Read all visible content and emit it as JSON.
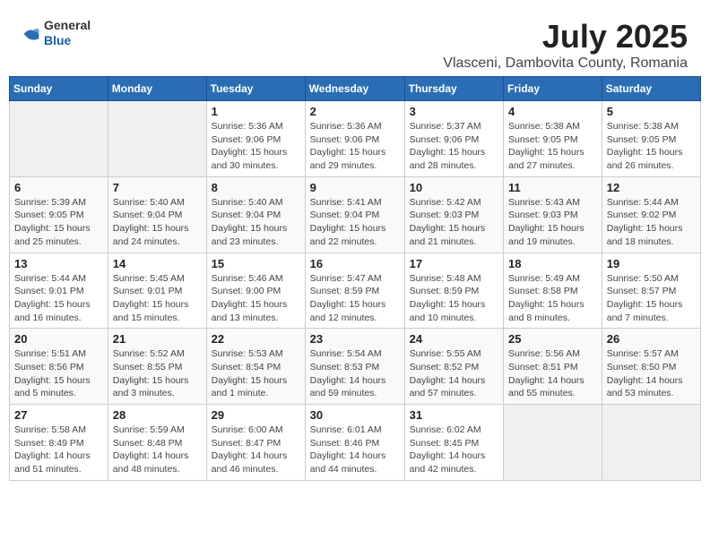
{
  "logo": {
    "general": "General",
    "blue": "Blue"
  },
  "title": "July 2025",
  "subtitle": "Vlasceni, Dambovita County, Romania",
  "weekdays": [
    "Sunday",
    "Monday",
    "Tuesday",
    "Wednesday",
    "Thursday",
    "Friday",
    "Saturday"
  ],
  "weeks": [
    [
      {
        "day": "",
        "info": ""
      },
      {
        "day": "",
        "info": ""
      },
      {
        "day": "1",
        "info": "Sunrise: 5:36 AM\nSunset: 9:06 PM\nDaylight: 15 hours and 30 minutes."
      },
      {
        "day": "2",
        "info": "Sunrise: 5:36 AM\nSunset: 9:06 PM\nDaylight: 15 hours and 29 minutes."
      },
      {
        "day": "3",
        "info": "Sunrise: 5:37 AM\nSunset: 9:06 PM\nDaylight: 15 hours and 28 minutes."
      },
      {
        "day": "4",
        "info": "Sunrise: 5:38 AM\nSunset: 9:05 PM\nDaylight: 15 hours and 27 minutes."
      },
      {
        "day": "5",
        "info": "Sunrise: 5:38 AM\nSunset: 9:05 PM\nDaylight: 15 hours and 26 minutes."
      }
    ],
    [
      {
        "day": "6",
        "info": "Sunrise: 5:39 AM\nSunset: 9:05 PM\nDaylight: 15 hours and 25 minutes."
      },
      {
        "day": "7",
        "info": "Sunrise: 5:40 AM\nSunset: 9:04 PM\nDaylight: 15 hours and 24 minutes."
      },
      {
        "day": "8",
        "info": "Sunrise: 5:40 AM\nSunset: 9:04 PM\nDaylight: 15 hours and 23 minutes."
      },
      {
        "day": "9",
        "info": "Sunrise: 5:41 AM\nSunset: 9:04 PM\nDaylight: 15 hours and 22 minutes."
      },
      {
        "day": "10",
        "info": "Sunrise: 5:42 AM\nSunset: 9:03 PM\nDaylight: 15 hours and 21 minutes."
      },
      {
        "day": "11",
        "info": "Sunrise: 5:43 AM\nSunset: 9:03 PM\nDaylight: 15 hours and 19 minutes."
      },
      {
        "day": "12",
        "info": "Sunrise: 5:44 AM\nSunset: 9:02 PM\nDaylight: 15 hours and 18 minutes."
      }
    ],
    [
      {
        "day": "13",
        "info": "Sunrise: 5:44 AM\nSunset: 9:01 PM\nDaylight: 15 hours and 16 minutes."
      },
      {
        "day": "14",
        "info": "Sunrise: 5:45 AM\nSunset: 9:01 PM\nDaylight: 15 hours and 15 minutes."
      },
      {
        "day": "15",
        "info": "Sunrise: 5:46 AM\nSunset: 9:00 PM\nDaylight: 15 hours and 13 minutes."
      },
      {
        "day": "16",
        "info": "Sunrise: 5:47 AM\nSunset: 8:59 PM\nDaylight: 15 hours and 12 minutes."
      },
      {
        "day": "17",
        "info": "Sunrise: 5:48 AM\nSunset: 8:59 PM\nDaylight: 15 hours and 10 minutes."
      },
      {
        "day": "18",
        "info": "Sunrise: 5:49 AM\nSunset: 8:58 PM\nDaylight: 15 hours and 8 minutes."
      },
      {
        "day": "19",
        "info": "Sunrise: 5:50 AM\nSunset: 8:57 PM\nDaylight: 15 hours and 7 minutes."
      }
    ],
    [
      {
        "day": "20",
        "info": "Sunrise: 5:51 AM\nSunset: 8:56 PM\nDaylight: 15 hours and 5 minutes."
      },
      {
        "day": "21",
        "info": "Sunrise: 5:52 AM\nSunset: 8:55 PM\nDaylight: 15 hours and 3 minutes."
      },
      {
        "day": "22",
        "info": "Sunrise: 5:53 AM\nSunset: 8:54 PM\nDaylight: 15 hours and 1 minute."
      },
      {
        "day": "23",
        "info": "Sunrise: 5:54 AM\nSunset: 8:53 PM\nDaylight: 14 hours and 59 minutes."
      },
      {
        "day": "24",
        "info": "Sunrise: 5:55 AM\nSunset: 8:52 PM\nDaylight: 14 hours and 57 minutes."
      },
      {
        "day": "25",
        "info": "Sunrise: 5:56 AM\nSunset: 8:51 PM\nDaylight: 14 hours and 55 minutes."
      },
      {
        "day": "26",
        "info": "Sunrise: 5:57 AM\nSunset: 8:50 PM\nDaylight: 14 hours and 53 minutes."
      }
    ],
    [
      {
        "day": "27",
        "info": "Sunrise: 5:58 AM\nSunset: 8:49 PM\nDaylight: 14 hours and 51 minutes."
      },
      {
        "day": "28",
        "info": "Sunrise: 5:59 AM\nSunset: 8:48 PM\nDaylight: 14 hours and 48 minutes."
      },
      {
        "day": "29",
        "info": "Sunrise: 6:00 AM\nSunset: 8:47 PM\nDaylight: 14 hours and 46 minutes."
      },
      {
        "day": "30",
        "info": "Sunrise: 6:01 AM\nSunset: 8:46 PM\nDaylight: 14 hours and 44 minutes."
      },
      {
        "day": "31",
        "info": "Sunrise: 6:02 AM\nSunset: 8:45 PM\nDaylight: 14 hours and 42 minutes."
      },
      {
        "day": "",
        "info": ""
      },
      {
        "day": "",
        "info": ""
      }
    ]
  ]
}
